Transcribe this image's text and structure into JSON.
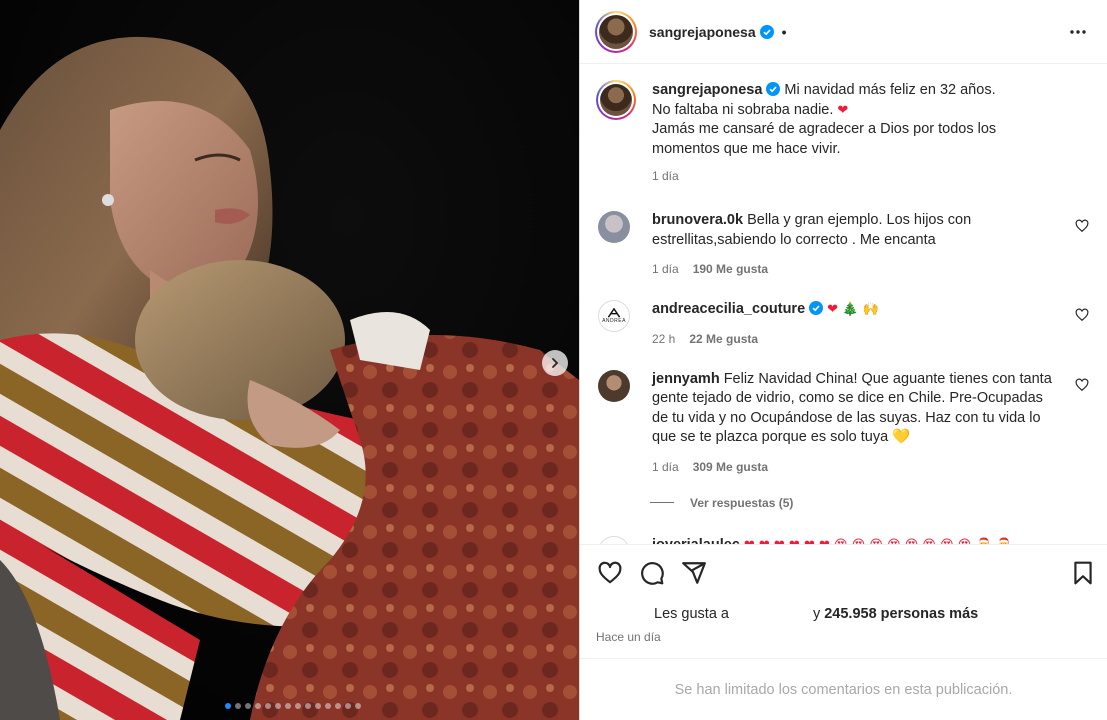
{
  "post": {
    "author": "sangrejaponesa",
    "separator": "•",
    "slides_count": 14,
    "active_slide": 1
  },
  "caption": {
    "user": "sangrejaponesa",
    "line1": "Mi navidad más feliz en 32 años.",
    "line2": "No faltaba ni sobraba nadie.",
    "line2_emoji": "❤",
    "line3": "Jamás me cansaré de agradecer a Dios por todos los momentos que me hace vivir.",
    "time": "1 día"
  },
  "comments": [
    {
      "user": "brunovera.0k",
      "text": "Bella y gran ejemplo. Los hijos con estrellitas,sabiendo lo correcto . Me encanta",
      "time": "1 día",
      "likes": "190 Me gusta"
    },
    {
      "user": "andreacecilia_couture",
      "text": "❤ 🎄 🙌",
      "time": "22 h",
      "likes": "22 Me gusta",
      "avatar_text": "ANDREA"
    },
    {
      "user": "jennyamh",
      "text": "Feliz Navidad China! Que aguante tienes con tanta gente tejado de vidrio, como se dice en Chile. Pre-Ocupadas de tu vida y no Ocupándose de las suyas. Haz con tu vida lo que se te plazca porque es solo tuya 💛",
      "time": "1 día",
      "likes": "309 Me gusta",
      "replies": "Ver respuestas (5)"
    },
    {
      "user": "joyerialaulec",
      "text": "❤ ❤ ❤ ❤ ❤ ❤ 😍 😍 😍 😍 😍 😍 😍 😍 🎅 🎅"
    }
  ],
  "footer": {
    "likes_prefix": "Les gusta a",
    "likes_suffix_pre": "y",
    "likes_count": "245.958 personas más",
    "posted": "Hace un día",
    "limited": "Se han limitado los comentarios en esta publicación."
  },
  "colors": {
    "verified": "#0095f6",
    "heart": "#ed1c3a",
    "muted": "#737373",
    "dot_active": "#1a8cff"
  },
  "icons": [
    "chevron-right-icon",
    "verified-icon",
    "more-icon",
    "heart-outline-icon",
    "comment-icon",
    "share-icon",
    "bookmark-icon"
  ]
}
